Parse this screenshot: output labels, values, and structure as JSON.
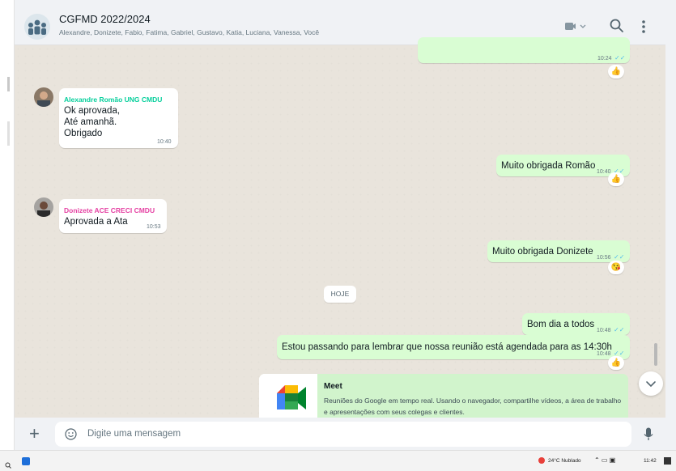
{
  "header": {
    "title": "CGFMD 2022/2024",
    "members": "Alexandre, Donizete, Fabio, Fatima, Gabriel, Gustavo, Katia, Luciana, Vanessa, Você"
  },
  "messages": [
    {
      "id": "m0",
      "direction": "out",
      "text": "",
      "time": "10:24",
      "reaction": "👍"
    },
    {
      "id": "m1",
      "direction": "in",
      "sender": "Alexandre Romão UNG CMDU",
      "sender_color": "#06cf9c",
      "lines": [
        "Ok aprovada,",
        "Até amanhã.",
        "Obrigado"
      ],
      "time": "10:40"
    },
    {
      "id": "m2",
      "direction": "out",
      "text": "Muito obrigada Romão",
      "time": "10:40",
      "reaction": "👍"
    },
    {
      "id": "m3",
      "direction": "in",
      "sender": "Donizete ACE CRECI CMDU",
      "sender_color": "#e542a3",
      "text": "Aprovada a Ata",
      "time": "10:53"
    },
    {
      "id": "m4",
      "direction": "out",
      "text": "Muito obrigada Donizete",
      "time": "10:56",
      "reaction": "😘"
    },
    {
      "id": "m5",
      "direction": "out",
      "text": "Bom dia a todos",
      "time": "10:48"
    },
    {
      "id": "m6",
      "direction": "out",
      "text": "Estou passando para lembrar que nossa reunião está agendada para as 14:30h",
      "time": "10:48",
      "reaction": "👍"
    }
  ],
  "date_chip": "HOJE",
  "link_preview": {
    "title": "Meet",
    "description": "Reuniões do Google em tempo real. Usando o navegador, compartilhe vídeos, a área de trabalho e apresentações com seus colegas e clientes."
  },
  "composer": {
    "placeholder": "Digite uma mensagem"
  },
  "taskbar": {
    "weather": "24°C  Nublado",
    "time": "11:42"
  },
  "colors": {
    "outgoing_bubble": "#d9fdd3",
    "incoming_bubble": "#ffffff",
    "read_ticks": "#53bdeb",
    "chat_background": "#efeae2"
  },
  "icons": [
    "group-avatar-icon",
    "video-call-icon",
    "search-icon",
    "menu-icon",
    "plus-icon",
    "emoji-icon",
    "mic-icon",
    "scroll-down-icon"
  ]
}
